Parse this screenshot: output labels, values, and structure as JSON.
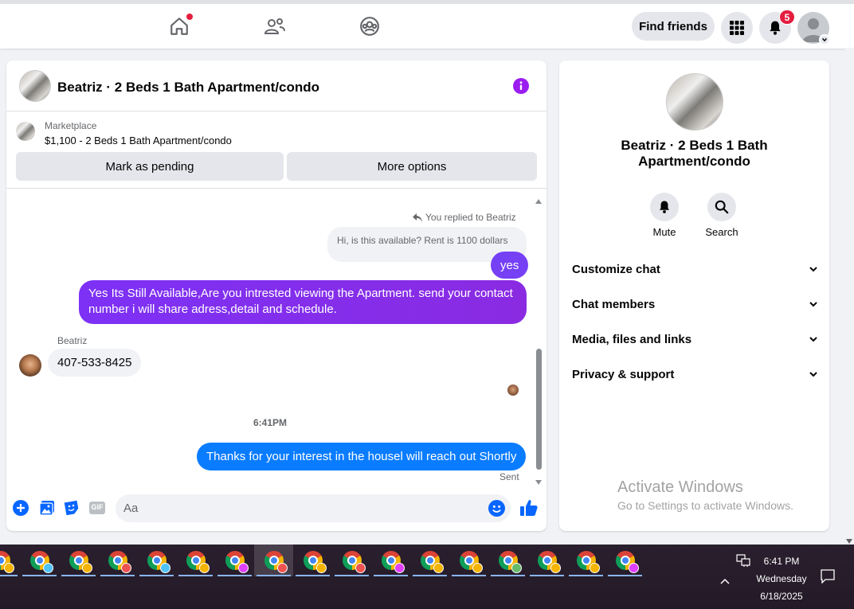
{
  "topnav": {
    "find_friends": "Find friends",
    "notifications_count": "5",
    "icons": [
      "home-icon",
      "friends-icon",
      "groups-icon",
      "menu-grid-icon",
      "bell-icon",
      "profile-avatar"
    ]
  },
  "chat": {
    "title": "Beatriz · 2 Beds 1 Bath Apartment/condo",
    "marketplace_label": "Marketplace",
    "listing": "$1,100 - 2 Beds 1 Bath Apartment/condo",
    "mark_pending": "Mark as pending",
    "more_options": "More options",
    "replied_to": "You replied to Beatriz",
    "quoted_message": "Hi, is this available? Rent is 1100 dollars",
    "messages": [
      {
        "from": "me",
        "text": "yes"
      },
      {
        "from": "me",
        "text": "Yes Its Still Available,Are you intrested viewing the Apartment. send your contact number i will share adress,detail and schedule."
      },
      {
        "from": "Beatriz",
        "text": "407-533-8425"
      },
      {
        "from": "me",
        "text": "Thanks for your interest in the housel will reach out Shortly"
      }
    ],
    "sender_name": "Beatriz",
    "timestamp": "6:41PM",
    "sent_status": "Sent",
    "composer_placeholder": "Aa",
    "gif_label": "GIF"
  },
  "side": {
    "name": "Beatriz · 2 Beds 1 Bath Apartment/condo",
    "mute": "Mute",
    "search": "Search",
    "rows": [
      "Customize chat",
      "Chat members",
      "Media, files and links",
      "Privacy & support"
    ]
  },
  "watermark": {
    "line1": "Activate Windows",
    "line2": "Go to Settings to activate Windows."
  },
  "taskbar": {
    "time": "6:41 PM",
    "day": "Wednesday",
    "date": "6/18/2025",
    "app_count": 17,
    "profile_colors": [
      "#f4b400",
      "#4fc3f7",
      "#f4b400",
      "#ef5350",
      "#4fc3f7",
      "#f4b400",
      "#e040fb",
      "#ef5350",
      "#f4b400",
      "#ef5350",
      "#e040fb",
      "#f4b400",
      "#f4b400",
      "#66bb6a",
      "#f4b400",
      "#f4b400",
      "#e040fb"
    ]
  },
  "colors": {
    "accent_blue": "#0a7cff",
    "accent_purple": "#7d31f5",
    "fb_blue": "#0866ff",
    "notification_red": "#e41e3f"
  }
}
